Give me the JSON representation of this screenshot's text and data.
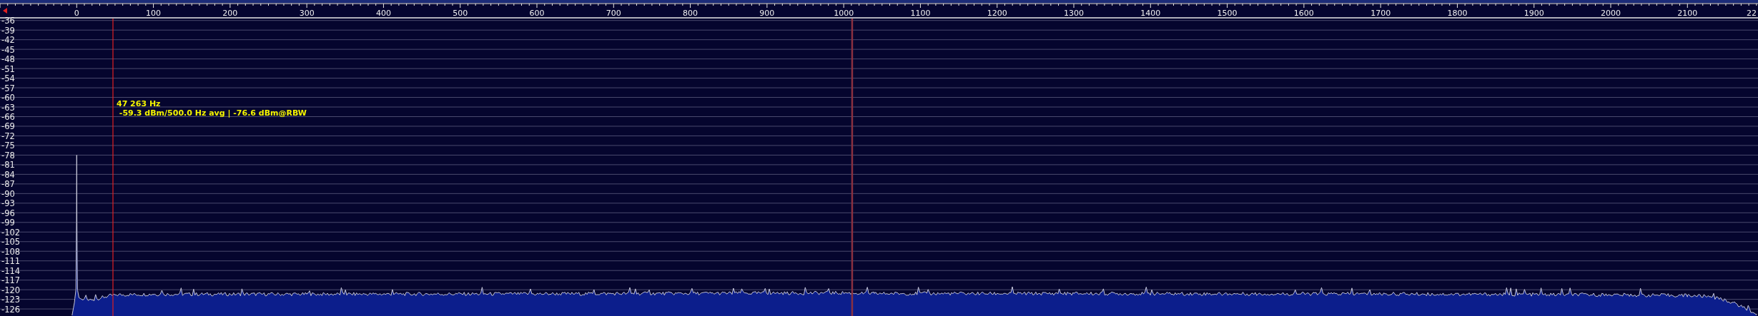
{
  "spectrum": {
    "edge_tick_label": "22",
    "chart_data": {
      "type": "area",
      "grid": true,
      "xlim": [
        -100,
        2192
      ],
      "ylim": [
        -128.2,
        -35.4
      ],
      "xticks": [
        0,
        100,
        200,
        300,
        400,
        500,
        600,
        700,
        800,
        900,
        1000,
        1100,
        1200,
        1300,
        1400,
        1500,
        1600,
        1700,
        1800,
        1900,
        2000,
        2100
      ],
      "yticks": [
        -36,
        -39,
        -42,
        -45,
        -48,
        -51,
        -54,
        -57,
        -60,
        -63,
        -66,
        -69,
        -72,
        -75,
        -78,
        -81,
        -84,
        -87,
        -90,
        -93,
        -96,
        -99,
        -102,
        -105,
        -108,
        -111,
        -114,
        -117,
        -120,
        -123,
        -126
      ],
      "x": [
        -6,
        -3,
        -1,
        -0.3,
        0,
        0.3,
        1,
        3,
        8,
        20,
        35,
        50,
        100,
        300,
        600,
        1000,
        1040,
        1300,
        1500,
        1700,
        2000,
        2100,
        2130,
        2160,
        2190
      ],
      "series": [
        {
          "color": "#c8c8d8",
          "values": [
            -128,
            -124,
            -120,
            -99,
            -78,
            -99,
            -120,
            -122.5,
            -123.2,
            -123.2,
            -122.3,
            -121.6,
            -121.4,
            -121.4,
            -121.3,
            -121,
            -121.2,
            -121.2,
            -121.3,
            -121.3,
            -121.6,
            -121.8,
            -122.1,
            -124,
            -127.5
          ]
        }
      ],
      "ref_lines": [
        {
          "axis": "x",
          "value": 47.263,
          "color": "#e02020"
        },
        {
          "axis": "x",
          "value": 1011,
          "color": "#8a3040"
        }
      ],
      "annotations": [
        "47 263 Hz",
        " -59.3 dBm/500.0 Hz avg | -76.6 dBm@RBW"
      ]
    }
  }
}
